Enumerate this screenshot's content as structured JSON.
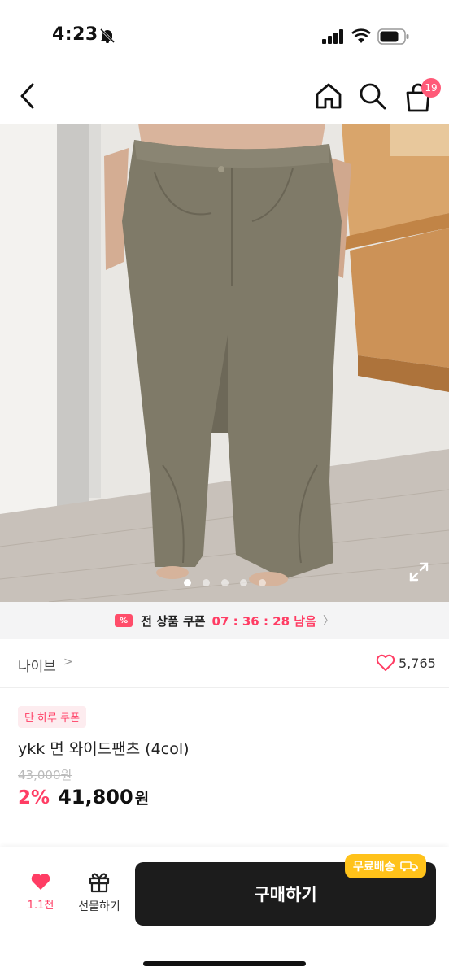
{
  "status_bar": {
    "time": "4:23",
    "icons": [
      "bell-slash-icon",
      "signal-icon",
      "wifi-icon",
      "battery-icon"
    ]
  },
  "nav": {
    "icons": [
      "back-arrow-icon",
      "home-icon",
      "search-icon",
      "shopping-bag-icon"
    ],
    "cart_count": "19"
  },
  "gallery": {
    "slide_count": 5,
    "active_index": 0,
    "expand_icon": "expand-icon"
  },
  "coupon_banner": {
    "label": "전 상품 쿠폰",
    "timer": "07 : 36 : 28 남음",
    "accent": "#ff3d64"
  },
  "brand": {
    "name": "나이브",
    "chevron": ">",
    "like_count": "5,765"
  },
  "product": {
    "promo_badge": "단 하루 쿠폰",
    "title": "ykk 면 와이드팬츠 (4col)",
    "original_price": "43,000원",
    "discount": "2%",
    "sale_price": "41,800",
    "currency": "원"
  },
  "bottom_bar": {
    "like_count": "1.1천",
    "gift_label": "선물하기",
    "buy_label": "구매하기",
    "shipping_badge": "무료배송"
  },
  "colors": {
    "accent_pink": "#ff3d64",
    "buy_button": "#1c1c1c",
    "shipping_badge": "#ffc21a"
  }
}
